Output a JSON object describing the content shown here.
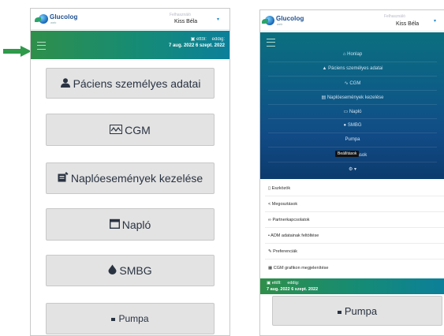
{
  "left": {
    "brand": "Glucolog",
    "brand_sub": "web",
    "role": "Felhasználó",
    "user": "Kiss Béla",
    "dates": {
      "from_label": "ettől:",
      "to_label": "eddig:",
      "from": "7 aug. 2022",
      "to": "6 szept. 2022"
    },
    "buttons": [
      {
        "label": "Páciens személyes adatai",
        "icon": "user-icon"
      },
      {
        "label": "CGM",
        "icon": "cgm-wave-icon"
      },
      {
        "label": "Naplóesemények kezelése",
        "icon": "log-edit-icon"
      },
      {
        "label": "Napló",
        "icon": "calendar-icon"
      },
      {
        "label": "SMBG",
        "icon": "drop-icon"
      },
      {
        "label": "Pumpa",
        "icon": "pump-icon"
      }
    ]
  },
  "right": {
    "brand": "Glucolog",
    "brand_sub": "web",
    "role": "Felhasználó",
    "user": "Kiss Béla",
    "menu": [
      {
        "label": "Honlap",
        "icon": "home-icon"
      },
      {
        "label": "Páciens személyes adatai",
        "icon": "user-icon"
      },
      {
        "label": "CGM",
        "icon": "cgm-wave-icon"
      },
      {
        "label": "Naplóesemények kezelése",
        "icon": "log-edit-icon"
      },
      {
        "label": "Napló",
        "icon": "calendar-icon"
      },
      {
        "label": "SMBG",
        "icon": "drop-icon"
      },
      {
        "label": "Pumpa",
        "icon": "pump-icon"
      },
      {
        "label": "Beállítások",
        "icon": "settings-icon"
      }
    ],
    "settings_tooltip": "Beállítások",
    "dropdown": [
      {
        "label": "Eszközök",
        "icon": "device-icon"
      },
      {
        "label": "Megosztások",
        "icon": "share-icon"
      },
      {
        "label": "Partnerkapcsolatok",
        "icon": "link-icon"
      },
      {
        "label": "ADM adatainak feltöltése",
        "icon": "upload-icon"
      },
      {
        "label": "Preferenciák",
        "icon": "wrench-icon"
      },
      {
        "label": "CGM grafikon megjelenítése",
        "icon": "chart-icon"
      }
    ],
    "dates": {
      "from_label": "ettől:",
      "to_label": "eddig:",
      "from": "7 aug. 2022",
      "to": "6 szept. 2022"
    },
    "bottom_button": {
      "label": "Pumpa",
      "icon": "pump-icon"
    }
  },
  "colors": {
    "accent_green": "#2f8f4a",
    "teal": "#0c7f9a",
    "navy": "#0c3b6d",
    "button_bg": "#e3e3e3",
    "arrow": "#2e9a4a"
  }
}
